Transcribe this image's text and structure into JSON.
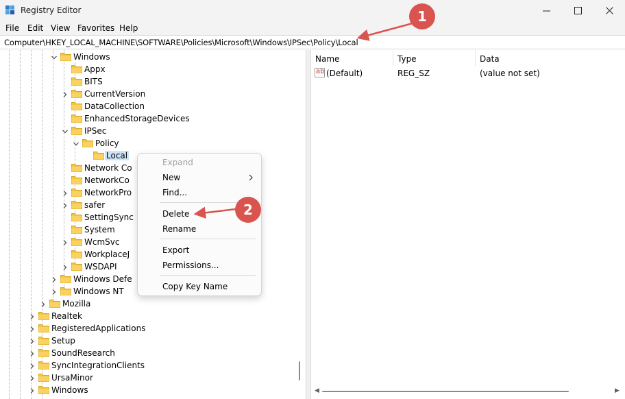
{
  "window": {
    "title": "Registry Editor",
    "icon": "registry-editor-icon",
    "controls": [
      "minimize-icon",
      "maximize-icon",
      "close-icon"
    ]
  },
  "menu": {
    "file": "File",
    "edit": "Edit",
    "view": "View",
    "favorites": "Favorites",
    "help": "Help"
  },
  "address": {
    "path": "Computer\\HKEY_LOCAL_MACHINE\\SOFTWARE\\Policies\\Microsoft\\Windows\\IPSec\\Policy\\Local"
  },
  "tree": {
    "items": [
      {
        "label": "Windows",
        "expanded": true
      },
      {
        "label": "Appx"
      },
      {
        "label": "BITS"
      },
      {
        "label": "CurrentVersion"
      },
      {
        "label": "DataCollection"
      },
      {
        "label": "EnhancedStorageDevices"
      },
      {
        "label": "IPSec",
        "expanded": true
      },
      {
        "label": "Policy",
        "expanded": true
      },
      {
        "label": "Local",
        "selected": true
      },
      {
        "label": "Network Co"
      },
      {
        "label": "NetworkCo"
      },
      {
        "label": "NetworkPro"
      },
      {
        "label": "safer"
      },
      {
        "label": "SettingSync"
      },
      {
        "label": "System"
      },
      {
        "label": "WcmSvc"
      },
      {
        "label": "WorkplaceJ"
      },
      {
        "label": "WSDAPI"
      },
      {
        "label": "Windows Defe"
      },
      {
        "label": "Windows NT"
      },
      {
        "label": "Mozilla"
      },
      {
        "label": "Realtek"
      },
      {
        "label": "RegisteredApplications"
      },
      {
        "label": "Setup"
      },
      {
        "label": "SoundResearch"
      },
      {
        "label": "SyncIntegrationClients"
      },
      {
        "label": "UrsaMinor"
      },
      {
        "label": "Windows"
      }
    ]
  },
  "list": {
    "columns": {
      "name": "Name",
      "type": "Type",
      "data": "Data"
    },
    "rows": [
      {
        "name": "(Default)",
        "type": "REG_SZ",
        "data": "(value not set)",
        "icon": "string-value-icon"
      }
    ]
  },
  "context_menu": {
    "expand": "Expand",
    "new": "New",
    "find": "Find...",
    "delete": "Delete",
    "rename": "Rename",
    "export": "Export",
    "permissions": "Permissions...",
    "copy_key_name": "Copy Key Name"
  },
  "callouts": {
    "one": "1",
    "two": "2"
  },
  "colors": {
    "callout": "#d9534f",
    "folder": "#f0c33c",
    "selection": "#cce4f7",
    "titlebar": "#f3f3f3"
  }
}
